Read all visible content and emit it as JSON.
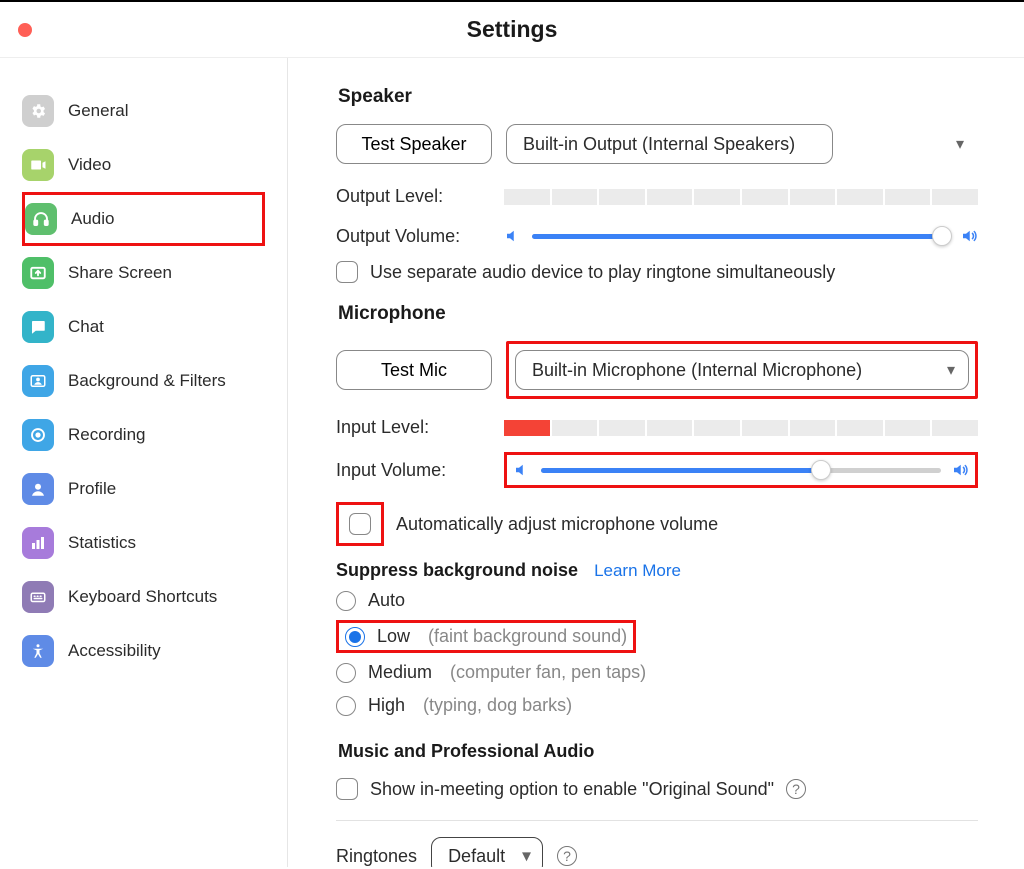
{
  "window": {
    "title": "Settings"
  },
  "sidebar": {
    "items": [
      {
        "label": "General",
        "color": "#cfcfcf",
        "icon": "gear"
      },
      {
        "label": "Video",
        "color": "#a7d36b",
        "icon": "video"
      },
      {
        "label": "Audio",
        "color": "#5fbf6e",
        "icon": "headphones",
        "selected": true
      },
      {
        "label": "Share Screen",
        "color": "#4fbf68",
        "icon": "share"
      },
      {
        "label": "Chat",
        "color": "#33b4c9",
        "icon": "chat"
      },
      {
        "label": "Background & Filters",
        "color": "#3fa6e6",
        "icon": "person"
      },
      {
        "label": "Recording",
        "color": "#3fa6e6",
        "icon": "record"
      },
      {
        "label": "Profile",
        "color": "#5f8be6",
        "icon": "profile"
      },
      {
        "label": "Statistics",
        "color": "#a77bdb",
        "icon": "stats"
      },
      {
        "label": "Keyboard Shortcuts",
        "color": "#8f7bb5",
        "icon": "keyboard"
      },
      {
        "label": "Accessibility",
        "color": "#5f8be6",
        "icon": "access"
      }
    ]
  },
  "main": {
    "speaker": {
      "heading": "Speaker",
      "testBtn": "Test Speaker",
      "device": "Built-in Output (Internal Speakers)",
      "outputLevelLabel": "Output Level:",
      "outputVolumeLabel": "Output Volume:",
      "outputVolumePct": 98,
      "separateCheckboxLabel": "Use separate audio device to play ringtone simultaneously"
    },
    "mic": {
      "heading": "Microphone",
      "testBtn": "Test Mic",
      "device": "Built-in Microphone (Internal Microphone)",
      "inputLevelLabel": "Input Level:",
      "inputLevelFilled": 1,
      "inputVolumeLabel": "Input Volume:",
      "inputVolumePct": 70,
      "autoAdjustLabel": "Automatically adjust microphone volume"
    },
    "suppress": {
      "heading": "Suppress background noise",
      "learn": "Learn More",
      "options": [
        {
          "label": "Auto",
          "hint": "",
          "checked": false
        },
        {
          "label": "Low",
          "hint": "(faint background sound)",
          "checked": true
        },
        {
          "label": "Medium",
          "hint": "(computer fan, pen taps)",
          "checked": false
        },
        {
          "label": "High",
          "hint": "(typing, dog barks)",
          "checked": false
        }
      ]
    },
    "music": {
      "heading": "Music and Professional Audio",
      "originalSound": "Show in-meeting option to enable \"Original Sound\""
    },
    "ringtones": {
      "label": "Ringtones",
      "selected": "Default"
    }
  }
}
